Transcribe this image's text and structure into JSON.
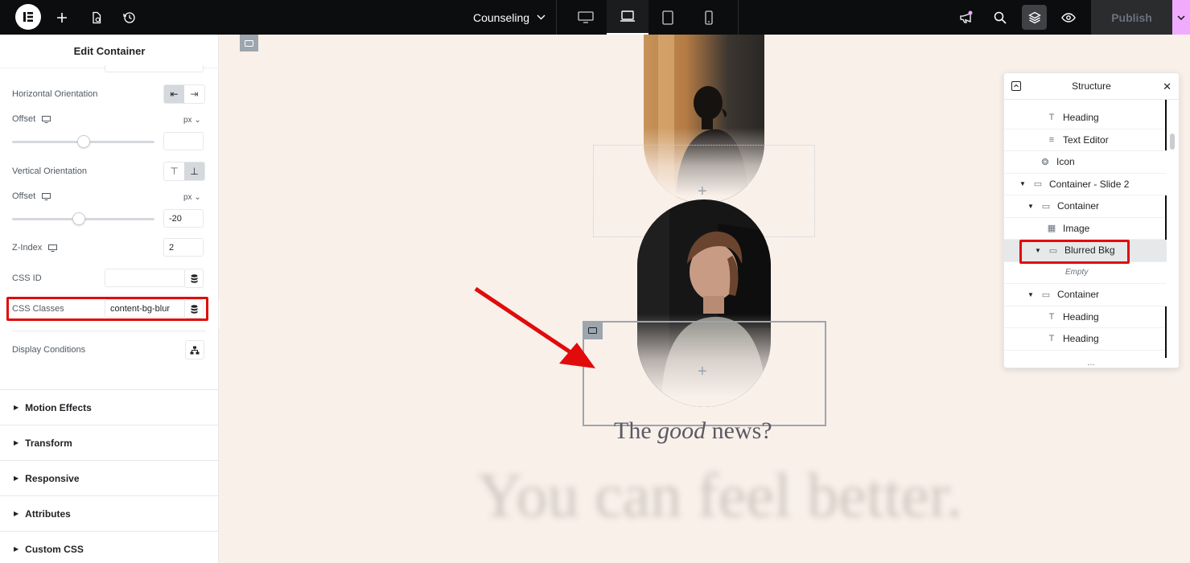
{
  "topbar": {
    "page_title": "Counseling",
    "publish_label": "Publish",
    "devices": [
      "desktop-icon",
      "laptop-icon",
      "tablet-icon",
      "mobile-icon"
    ],
    "accent": "#f0abfc"
  },
  "panel": {
    "title": "Edit Container",
    "horizontal_orientation_label": "Horizontal Orientation",
    "offset_label": "Offset",
    "unit": "px",
    "vertical_orientation_label": "Vertical Orientation",
    "v_offset_value": "-20",
    "v_offset_level": 0.47,
    "h_offset_level": 0.5,
    "z_index_label": "Z-Index",
    "z_index_value": "2",
    "css_id_label": "CSS ID",
    "css_classes_label": "CSS Classes",
    "css_classes_value": "content-bg-blur",
    "display_conditions_label": "Display Conditions",
    "sections": [
      "Motion Effects",
      "Transform",
      "Responsive",
      "Attributes",
      "Custom CSS"
    ]
  },
  "canvas": {
    "good_news_pre": "The ",
    "good_news_em": "good",
    "good_news_post": " news?",
    "feel_better": "You can feel better."
  },
  "structure": {
    "title": "Structure",
    "items": [
      {
        "label": "Heading",
        "icon": "heading-icon"
      },
      {
        "label": "Text Editor",
        "icon": "text-editor-icon"
      },
      {
        "label": "Icon",
        "icon": "icon-widget-icon"
      },
      {
        "label": "Container - Slide 2",
        "icon": "container-icon"
      },
      {
        "label": "Container",
        "icon": "container-icon"
      },
      {
        "label": "Image",
        "icon": "image-icon"
      },
      {
        "label": "Blurred Bkg",
        "icon": "container-icon"
      },
      {
        "label": "Empty",
        "icon": ""
      },
      {
        "label": "Container",
        "icon": "container-icon"
      },
      {
        "label": "Heading",
        "icon": "heading-icon"
      },
      {
        "label": "Heading",
        "icon": "heading-icon"
      }
    ]
  },
  "highlight_color": "#e10b0b"
}
